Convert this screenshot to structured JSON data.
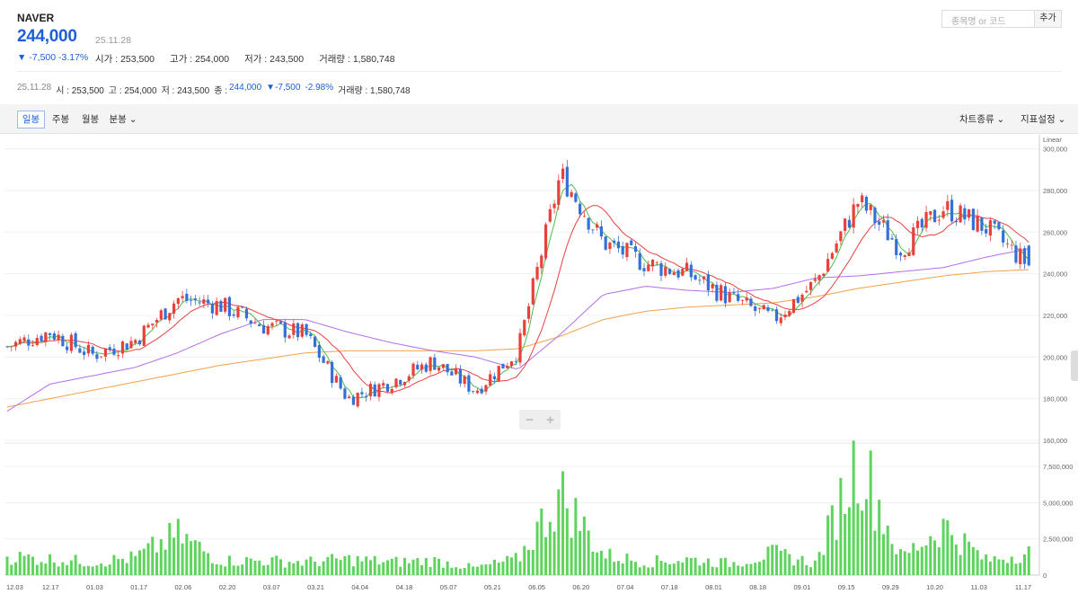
{
  "stock": {
    "name": "NAVER",
    "price": "244,000",
    "date": "25.11.28",
    "change": "▼ -7,500 -3.17%",
    "stats": [
      "시가 : 253,500",
      "고가 : 254,000",
      "저가 : 243,500",
      "거래량 : 1,580,748"
    ]
  },
  "search": {
    "placeholder": "종목명 or 코드",
    "add_label": "추가"
  },
  "info": {
    "date": "25.11.28",
    "open": "시 : 253,500",
    "high": "고 : 254,000",
    "low": "저 : 243,500",
    "close_label": "종 :",
    "close": "244,000",
    "change": "▼-7,500",
    "pct": "-2.98%",
    "volume": "거래량 : 1,580,748"
  },
  "toolbar": {
    "periods": [
      "일봉",
      "주봉",
      "월봉",
      "분봉 ⌄"
    ],
    "active_period": "일봉",
    "chart_type": "차트종류 ⌄",
    "indicators": "지표설정 ⌄"
  },
  "zoom": {
    "minus": "−",
    "plus": "+"
  },
  "colors": {
    "up": "#e8403b",
    "down": "#3570d8",
    "ma5": "#4bbf4b",
    "ma20": "#e84040",
    "ma60": "#b26ee8",
    "ma120": "#f0a24a",
    "volume": "#5ed35e"
  },
  "chart_data": {
    "type": "candlestick",
    "scale_label": "Linear",
    "ylim": [
      160000,
      305000
    ],
    "price_ticks": [
      "300,000",
      "280,000",
      "260,000",
      "240,000",
      "220,000",
      "200,000",
      "180,000",
      "160,000"
    ],
    "volume_ticks": [
      "7,500,000",
      "5,000,000",
      "2,500,000",
      "0"
    ],
    "x_ticks": [
      "12.03",
      "12.17",
      "01.03",
      "01.17",
      "02.06",
      "02.20",
      "03.07",
      "03.21",
      "04.04",
      "04.18",
      "05.07",
      "05.21",
      "06.05",
      "06.20",
      "07.04",
      "07.18",
      "08.01",
      "08.18",
      "09.01",
      "09.15",
      "09.29",
      "10.20",
      "11.03",
      "11.17"
    ],
    "series": [
      {
        "name": "price",
        "x": [
          "12.03",
          "12.17",
          "01.03",
          "01.17",
          "02.06",
          "02.20",
          "03.07",
          "03.21",
          "04.04",
          "04.18",
          "05.07",
          "05.21",
          "06.05",
          "06.20",
          "07.04",
          "07.18",
          "08.01",
          "08.18",
          "09.01",
          "09.15",
          "09.29",
          "10.20",
          "11.03",
          "11.17",
          "11.28"
        ],
        "values": [
          205000,
          212000,
          201000,
          208000,
          228000,
          225000,
          215000,
          211000,
          180000,
          188000,
          198000,
          184000,
          203000,
          288000,
          255000,
          245000,
          240000,
          228000,
          218000,
          236000,
          275000,
          252000,
          272000,
          262000,
          244000
        ]
      },
      {
        "name": "MA120",
        "values": [
          176000,
          180000,
          184000,
          188000,
          192000,
          196000,
          199000,
          202000,
          203000,
          203000,
          203000,
          203000,
          204000,
          210000,
          218000,
          222000,
          224000,
          225000,
          226000,
          229000,
          233000,
          236000,
          239000,
          241000,
          242000
        ]
      },
      {
        "name": "MA60",
        "values": [
          174000,
          187000,
          191000,
          195000,
          202000,
          211000,
          218000,
          218000,
          212000,
          207000,
          203000,
          200000,
          194000,
          211000,
          230000,
          234000,
          232000,
          231000,
          233000,
          238000,
          239000,
          241000,
          243000,
          248000,
          252000
        ]
      },
      {
        "name": "volume",
        "values": [
          1300000,
          1100000,
          900000,
          1200000,
          2800000,
          1000000,
          1000000,
          900000,
          1100000,
          900000,
          1000000,
          500000,
          1100000,
          5600000,
          1400000,
          900000,
          1100000,
          800000,
          1500000,
          800000,
          8300000,
          1200000,
          3400000,
          1000000,
          1580748
        ]
      }
    ]
  }
}
